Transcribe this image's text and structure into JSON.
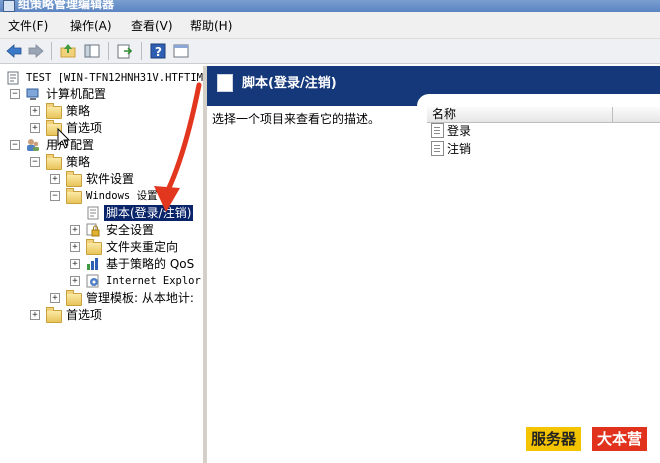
{
  "window": {
    "title": "组策略管理编辑器"
  },
  "menu": [
    {
      "label": "文件(F)"
    },
    {
      "label": "操作(A)"
    },
    {
      "label": "查看(V)"
    },
    {
      "label": "帮助(H)"
    }
  ],
  "toolbar": {
    "buttons": [
      "back-arrow-icon",
      "forward-arrow-icon",
      "up-folder-icon",
      "show-hide-tree-icon",
      "export-list-icon",
      "help-icon",
      "properties-icon"
    ]
  },
  "tree": {
    "root": "TEST [WIN-TFN12HNH31V.HTFTIM",
    "computer_config": "计算机配置",
    "cc_policies": "策略",
    "cc_preferences": "首选项",
    "user_config": "用户配置",
    "uc_policies": "策略",
    "software_settings": "软件设置",
    "windows_settings": "Windows 设置",
    "scripts": "脚本(登录/注销)",
    "security_settings": "安全设置",
    "folder_redirection": "文件夹重定向",
    "policy_qos": "基于策略的 QoS",
    "internet_explorer": "Internet Explor",
    "admin_templates": "管理模板: 从本地计:",
    "uc_preferences": "首选项"
  },
  "detail": {
    "header_title": "脚本(登录/注销)",
    "description": "选择一个项目来查看它的描述。",
    "column_name": "名称",
    "items": [
      {
        "label": "登录"
      },
      {
        "label": "注销"
      }
    ]
  },
  "colors": {
    "header_bg": "#14387a",
    "selection_bg": "#0a246a",
    "annotation_arrow": "#e3361e"
  },
  "watermark": {
    "part1": "服务器",
    "part2": "大本营"
  }
}
